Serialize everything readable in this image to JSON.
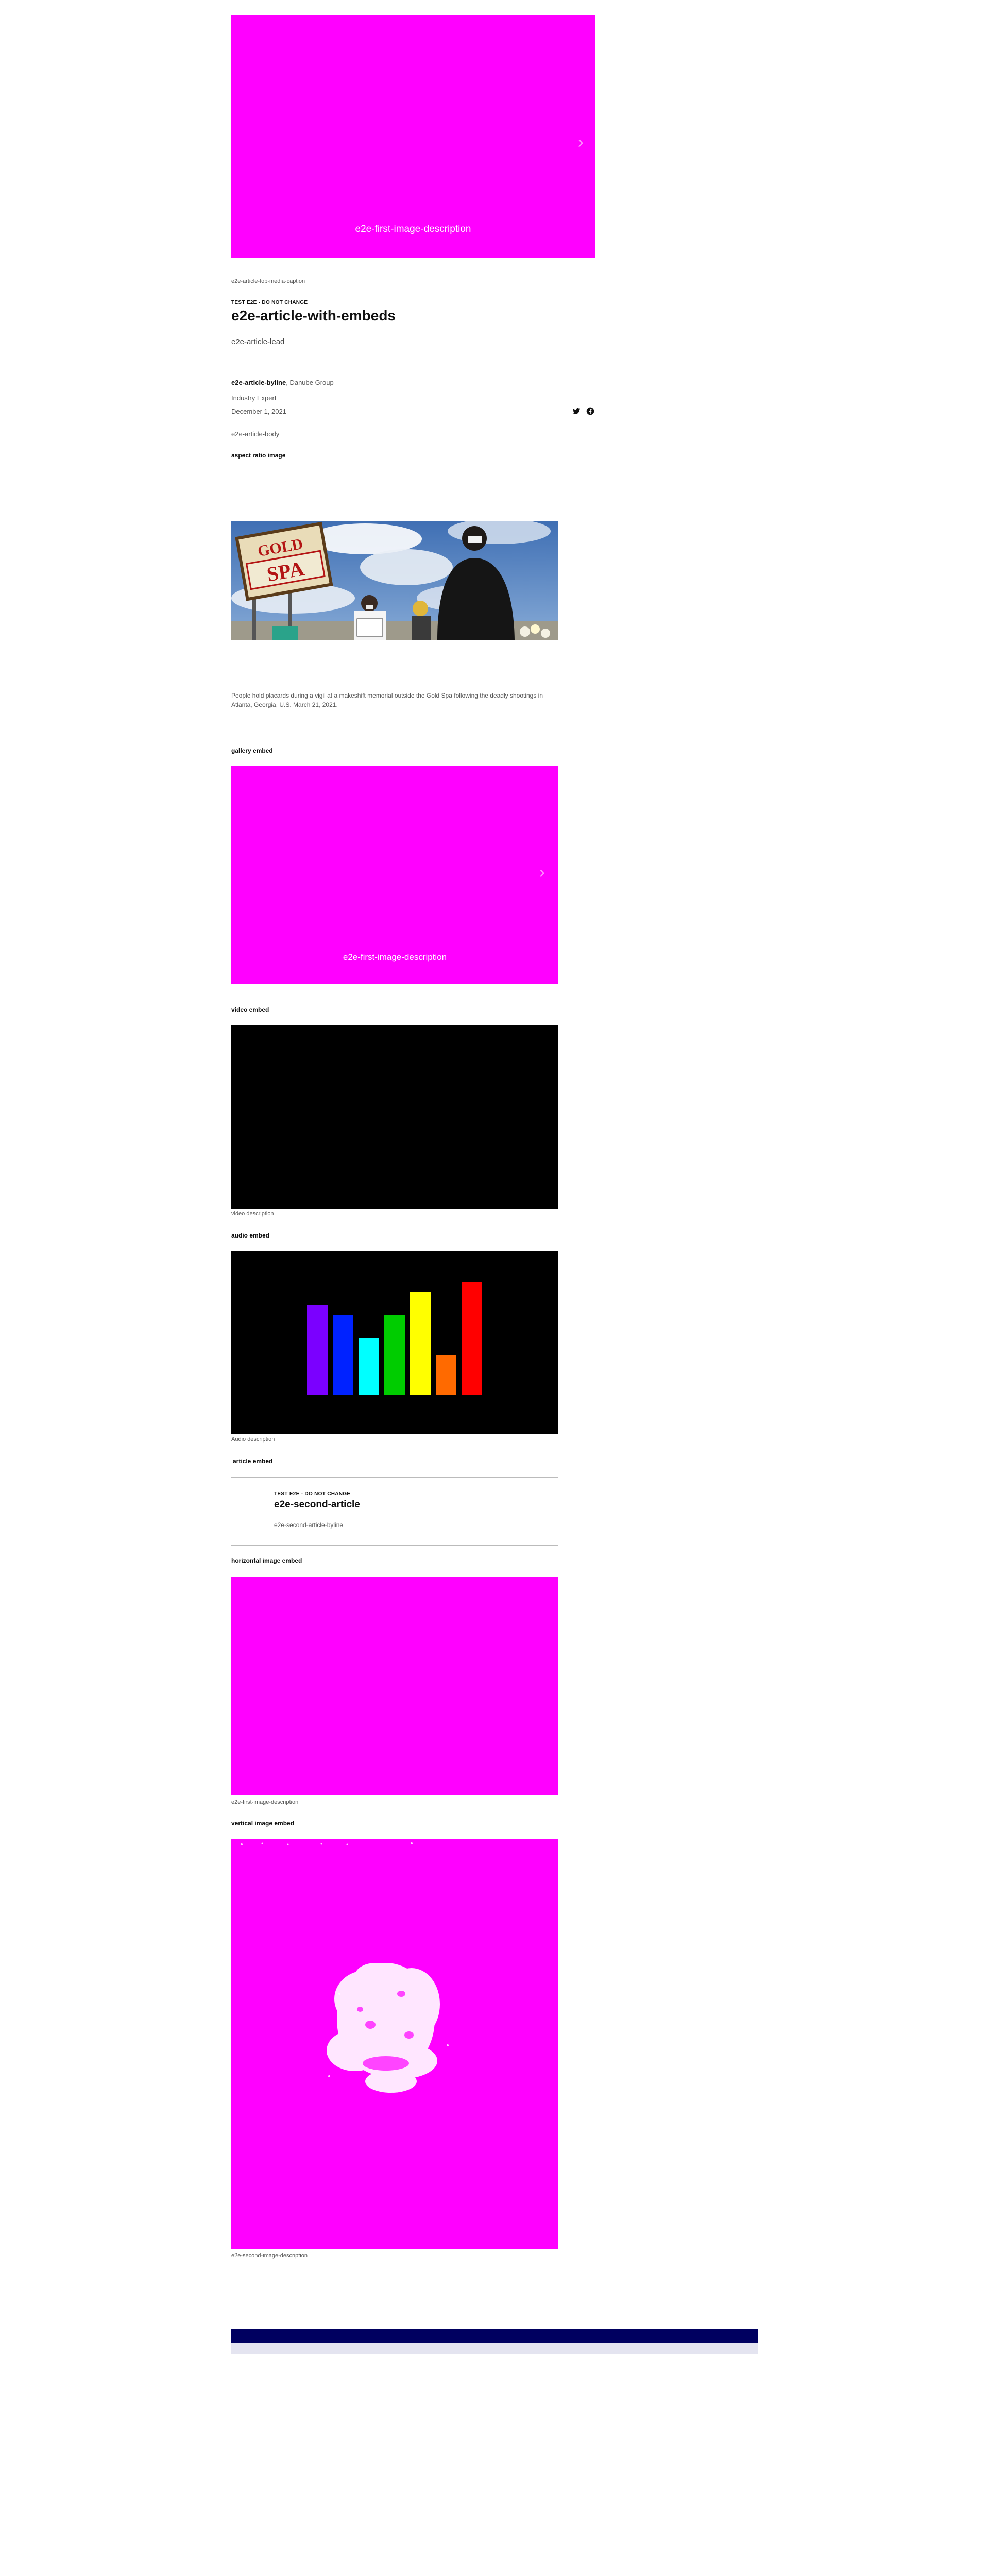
{
  "hero": {
    "image_description": "e2e-first-image-description",
    "caption": "e2e-article-top-media-caption"
  },
  "article": {
    "kicker": "TEST E2E - DO NOT CHANGE",
    "title": "e2e-article-with-embeds",
    "lead": "e2e-article-lead",
    "byline_name": "e2e-article-byline",
    "byline_org": "Danube Group",
    "byline_role": "Industry Expert",
    "date": "December 1, 2021",
    "body": "e2e-article-body"
  },
  "share": {
    "twitter_icon": "twitter-icon",
    "facebook_icon": "facebook-icon"
  },
  "aspect_ratio_section": {
    "label": "aspect ratio image",
    "caption_line1": "People hold placards during a vigil at a makeshift memorial outside the Gold Spa following the deadly shootings in",
    "caption_line2": "Atlanta, Georgia, U.S. March 21, 2021.",
    "sign_top": "GOLD",
    "sign_bottom": "SPA"
  },
  "gallery_section": {
    "label": "gallery embed",
    "image_description": "e2e-first-image-description"
  },
  "video_section": {
    "label": "video embed",
    "description": "video description"
  },
  "audio_section": {
    "label": "audio embed",
    "description": "Audio description",
    "bars": [
      {
        "value": 0.7,
        "color": "#7b00ff"
      },
      {
        "value": 0.62,
        "color": "#0022ff"
      },
      {
        "value": 0.44,
        "color": "#00ffff"
      },
      {
        "value": 0.62,
        "color": "#00cc00"
      },
      {
        "value": 0.8,
        "color": "#ffff00"
      },
      {
        "value": 0.31,
        "color": "#ff6a00"
      },
      {
        "value": 0.88,
        "color": "#ff0000"
      }
    ]
  },
  "article_embed_section": {
    "label": "article embed",
    "kicker": "TEST E2E - DO NOT CHANGE",
    "title": "e2e-second-article",
    "byline": "e2e-second-article-byline"
  },
  "horizontal_section": {
    "label": "horizontal image embed",
    "caption": "e2e-first-image-description"
  },
  "vertical_section": {
    "label": "vertical image embed",
    "caption": "e2e-second-image-description"
  },
  "colors": {
    "placeholder": "#ff00ff",
    "footer_bar": "#000060",
    "footer_sub": "#e4e4f0"
  }
}
